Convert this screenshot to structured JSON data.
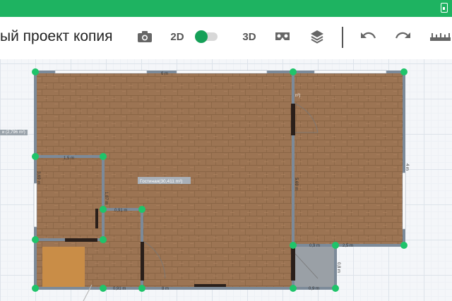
{
  "project": {
    "title": "ый проект копия"
  },
  "toolbar": {
    "mode_2d": "2D",
    "mode_3d": "3D",
    "icons": [
      "camera-icon",
      "vr-headset-icon",
      "layers-icon",
      "undo-icon",
      "redo-icon",
      "ruler-icon"
    ]
  },
  "plan": {
    "room_label": "Гостиная(30,411 m²)",
    "side_room_label": "n²)",
    "left_label": "и (2,796 m²)",
    "dims": {
      "top": "6 m",
      "right": "4 m",
      "inner_wall": "5,69 m",
      "left": "3,69 m",
      "small_room_top": "1,5 m",
      "small_room_side": "1,87 m",
      "corridor_top": "0,91 m",
      "bottom_left": "0,91 m",
      "bottom_mid": "8 m",
      "bottom_right": "0,9 m",
      "right_step_a": "0,9 m",
      "right_step_b": "2,5 m",
      "right_step_side": "0,8 m"
    }
  },
  "colors": {
    "accent": "#1eb361",
    "wall": "#7c8a99",
    "node": "#1fc46a",
    "floor": "#9c7453"
  }
}
